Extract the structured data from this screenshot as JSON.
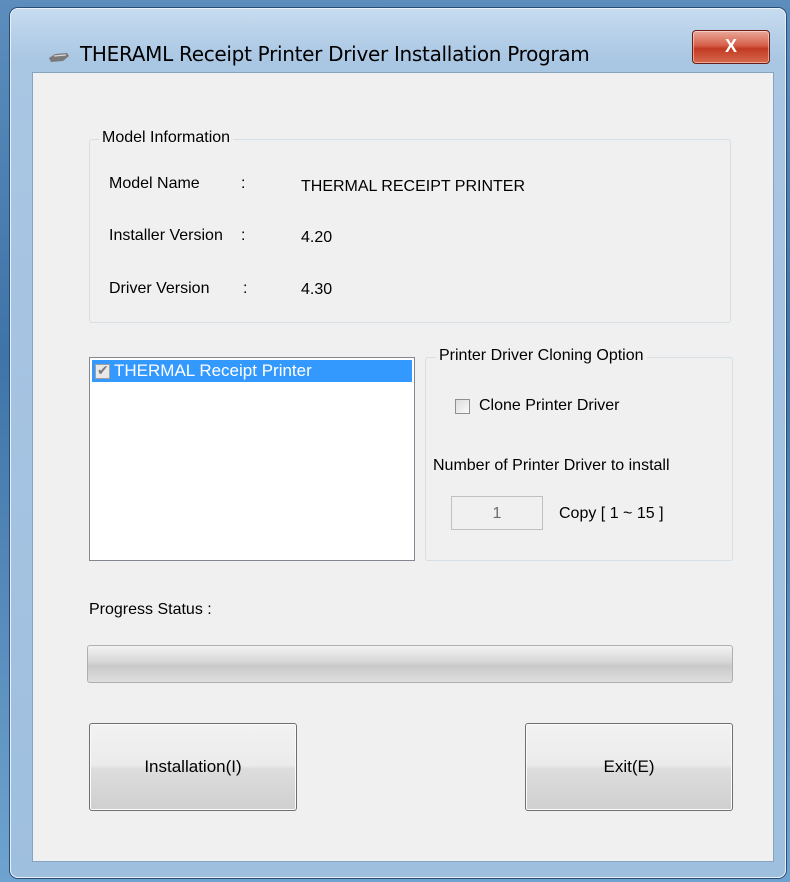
{
  "window": {
    "title": "THERAML Receipt Printer Driver Installation Program",
    "close_label": "X"
  },
  "model_info": {
    "group_label": "Model Information",
    "rows": [
      {
        "label": "Model Name",
        "sep": ":",
        "value": "THERMAL RECEIPT PRINTER"
      },
      {
        "label": "Installer Version",
        "sep": ":",
        "value": "4.20"
      },
      {
        "label": "Driver Version",
        "sep": ":",
        "value": "4.30"
      }
    ]
  },
  "printer_list": {
    "items": [
      {
        "label": "THERMAL Receipt Printer",
        "checked": true,
        "selected": true
      }
    ]
  },
  "cloning": {
    "group_label": "Printer Driver Cloning Option",
    "checkbox_label": "Clone Printer Driver",
    "checkbox_checked": false,
    "count_label": "Number of Printer Driver to install",
    "count_value": "1",
    "copy_range": "Copy [ 1 ~ 15 ]"
  },
  "progress": {
    "label": "Progress Status :",
    "value": 0
  },
  "buttons": {
    "install": "Installation(I)",
    "exit": "Exit(E)"
  },
  "icons": {
    "title": "printer-icon",
    "check": "check-icon"
  }
}
